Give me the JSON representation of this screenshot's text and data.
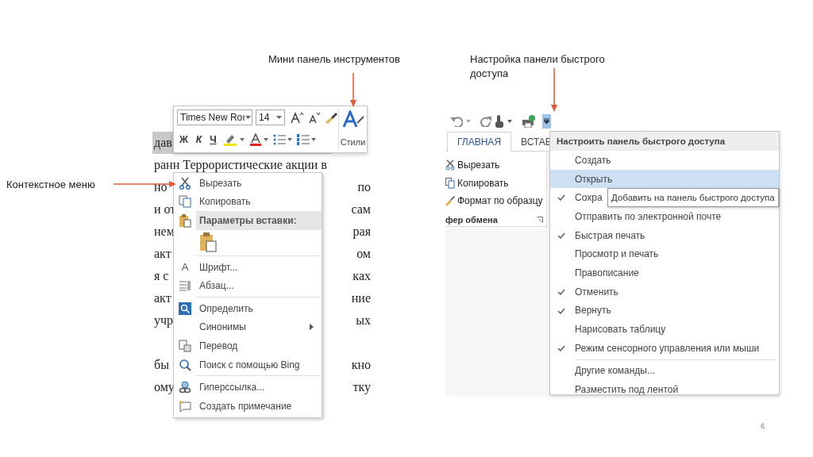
{
  "labels": {
    "mini_toolbar": "Мини панель инструментов",
    "qat": "Настройка панели быстрого доступа",
    "context_menu": "Контекстное меню"
  },
  "document": {
    "paragraphs": [
      [
        {
          "left": "дав",
          "selected": true
        },
        {
          "left": "ранн Террористические акции в",
          "selected": false
        },
        {
          "left": "но",
          "right": "по",
          "selected": false
        },
        {
          "left": "и от",
          "right": "сам",
          "selected": false
        },
        {
          "left": "нем",
          "right": "рая",
          "selected": false
        },
        {
          "left": "акт",
          "right": "ом",
          "selected": false
        },
        {
          "left": "я с",
          "right": "ках",
          "selected": false
        },
        {
          "left": "акт",
          "right": "ние",
          "selected": false
        },
        {
          "left": "учр",
          "right": "ых",
          "selected": false
        }
      ],
      [
        {
          "left": "бы",
          "right": "кно",
          "selected": false
        },
        {
          "left": "ому",
          "right": "тку",
          "selected": false
        }
      ]
    ]
  },
  "mini_toolbar": {
    "font": "Times New Roı",
    "size": "14",
    "format_buttons": [
      "Ж",
      "К",
      "Ч"
    ],
    "styles_label": "Стили"
  },
  "context_menu": {
    "items": [
      {
        "kind": "command",
        "label": "Вырезать"
      },
      {
        "kind": "command",
        "label": "Копировать"
      },
      {
        "kind": "header",
        "label": "Параметры вставки:"
      },
      {
        "kind": "paste_options"
      },
      {
        "kind": "separator"
      },
      {
        "kind": "command",
        "label": "Шрифт...",
        "glyph": "A"
      },
      {
        "kind": "command",
        "label": "Абзац..."
      },
      {
        "kind": "separator"
      },
      {
        "kind": "command",
        "label": "Определить"
      },
      {
        "kind": "command",
        "label": "Синонимы",
        "submenu": true
      },
      {
        "kind": "command",
        "label": "Перевод"
      },
      {
        "kind": "command",
        "label": "Поиск с помощью Bing"
      },
      {
        "kind": "separator"
      },
      {
        "kind": "command",
        "label": "Гиперссылка..."
      },
      {
        "kind": "command",
        "label": "Создать примечание"
      }
    ]
  },
  "ribbon": {
    "tabs": [
      {
        "label": "ГЛАВНАЯ",
        "selected": true
      },
      {
        "label": "ВСТАВ",
        "selected": false
      }
    ],
    "clipboard": [
      "Вырезать",
      "Копировать",
      "Формат по образцу"
    ],
    "group_label": "фер обмена"
  },
  "qat_menu": {
    "title": "Настроить панель быстрого доступа",
    "tooltip": "Добавить на панель быстрого доступа",
    "items": [
      {
        "kind": "item",
        "label": "Создать",
        "checked": false,
        "selected": false
      },
      {
        "kind": "item",
        "label": "Открыть",
        "checked": false,
        "selected": true
      },
      {
        "kind": "item",
        "label": "Сохра",
        "checked": true,
        "selected": false,
        "tooltip": true
      },
      {
        "kind": "item",
        "label": "Отправить по электронной почте",
        "checked": false,
        "selected": false
      },
      {
        "kind": "item",
        "label": "Быстрая печать",
        "checked": true,
        "selected": false
      },
      {
        "kind": "item",
        "label": "Просмотр и печать",
        "checked": false,
        "selected": false
      },
      {
        "kind": "item",
        "label": "Правописание",
        "checked": false,
        "selected": false
      },
      {
        "kind": "item",
        "label": "Отменить",
        "checked": true,
        "selected": false
      },
      {
        "kind": "item",
        "label": "Вернуть",
        "checked": true,
        "selected": false
      },
      {
        "kind": "item",
        "label": "Нарисовать таблицу",
        "checked": false,
        "selected": false
      },
      {
        "kind": "item",
        "label": "Режим сенсорного управления или мыши",
        "checked": true,
        "selected": false
      },
      {
        "kind": "separator"
      },
      {
        "kind": "item",
        "label": "Другие команды...",
        "checked": false,
        "selected": false
      },
      {
        "kind": "item",
        "label": "Разместить под лентой",
        "checked": false,
        "selected": false
      }
    ]
  },
  "page_number": "6"
}
